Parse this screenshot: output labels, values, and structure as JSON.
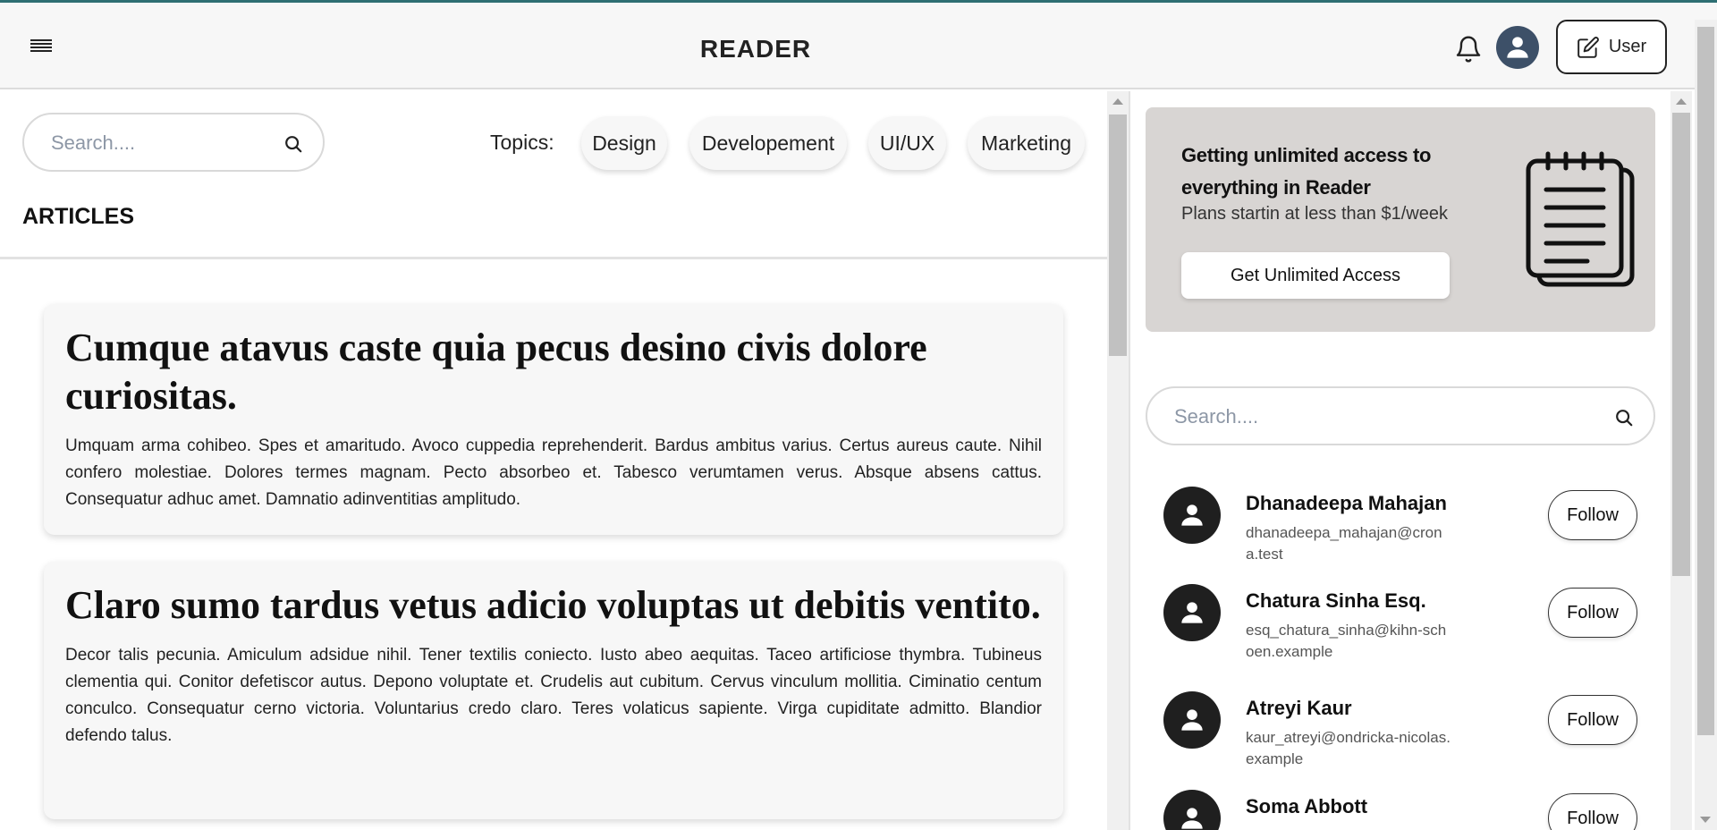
{
  "header": {
    "brand": "READER",
    "user_button_label": "User"
  },
  "left": {
    "search_placeholder": "Search....",
    "topics_label": "Topics:",
    "topics": [
      "Design",
      "Developement",
      "UI/UX",
      "Marketing"
    ],
    "articles_heading": "ARTICLES",
    "articles": [
      {
        "title": "Cumque atavus caste quia pecus desino civis dolore curiositas.",
        "body": "Umquam arma cohibeo. Spes et amaritudo. Avoco cuppedia reprehenderit. Bardus ambitus varius. Certus aureus caute. Nihil confero molestiae. Dolores termes magnam. Pecto absorbeo et. Tabesco verumtamen verus. Absque absens cattus. Consequatur adhuc amet. Damnatio adinventitias amplitudo."
      },
      {
        "title": "Claro sumo tardus vetus adicio voluptas ut debitis ventito.",
        "body": "Decor talis pecunia. Amiculum adsidue nihil. Tener textilis coniecto. Iusto abeo aequitas. Taceo artificiose thymbra. Tubineus clementia qui. Conitor defetiscor autus. Depono voluptate et. Crudelis aut cubitum. Cervus vinculum mollitia. Ciminatio centum conculco. Consequatur cerno victoria. Voluntarius credo claro. Teres volaticus sapiente. Virga cupiditate admitto. Blandior defendo talus."
      }
    ]
  },
  "right": {
    "promo": {
      "title": "Getting unlimited access to everything in Reader",
      "subtitle": "Plans startin at less than $1/week",
      "button_label": "Get Unlimited Access"
    },
    "search_placeholder": "Search....",
    "follow_label": "Follow",
    "people": [
      {
        "name": "Dhanadeepa Mahajan",
        "email": "dhanadeepa_mahajan@crona.test"
      },
      {
        "name": "Chatura Sinha Esq.",
        "email": "esq_chatura_sinha@kihn-schoen.example"
      },
      {
        "name": "Atreyi Kaur",
        "email": "kaur_atreyi@ondricka-nicolas.example"
      },
      {
        "name": "Soma Abbott",
        "email": ""
      }
    ]
  },
  "colors": {
    "accent_bar": "#2e6f73",
    "avatar_top": "#3d5068",
    "promo_bg": "#d8d5d3"
  },
  "icons": {
    "menu": "hamburger-icon",
    "notifications": "bell-icon",
    "edit": "pencil-square-icon",
    "search": "search-icon",
    "promo": "notepad-icon",
    "person": "user-icon"
  }
}
